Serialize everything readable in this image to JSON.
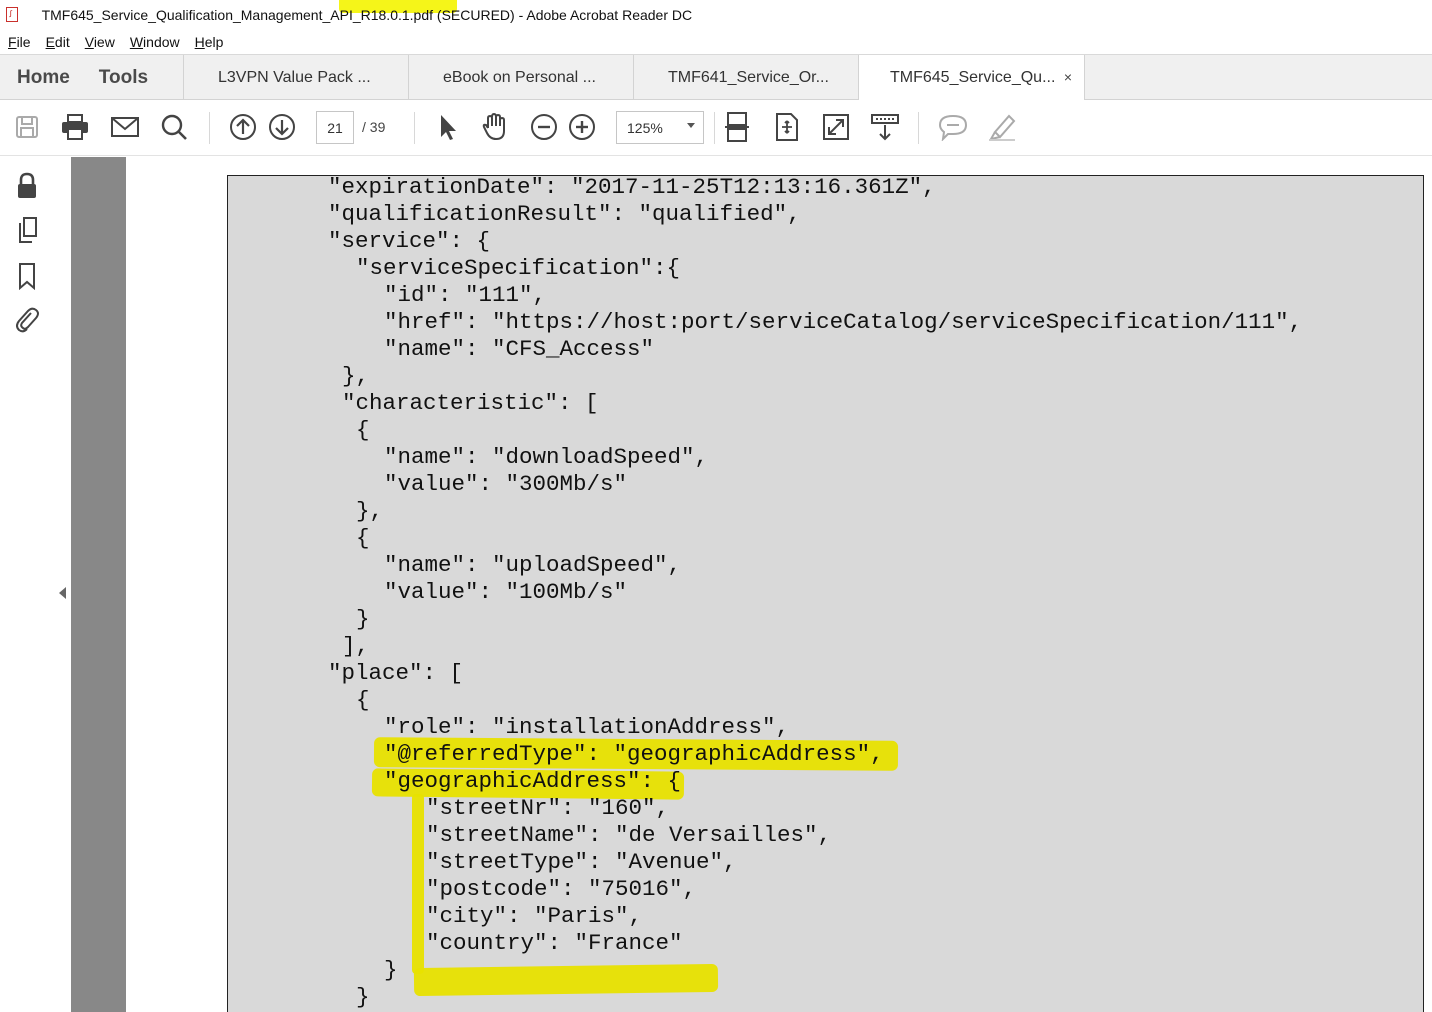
{
  "window": {
    "title_prefix": "TMF645_Service_Qualification_Management_A",
    "title_highlighted": "PI_R18.0.1.pdf",
    "title_suffix": " (SECURED) - Adobe Acrobat Reader DC"
  },
  "menu": {
    "items": [
      {
        "first": "F",
        "rest": "ile"
      },
      {
        "first": "E",
        "rest": "dit"
      },
      {
        "first": "V",
        "rest": "iew"
      },
      {
        "first": "W",
        "rest": "indow"
      },
      {
        "first": "H",
        "rest": "elp"
      }
    ]
  },
  "nav": {
    "home": "Home",
    "tools": "Tools"
  },
  "tabs": [
    {
      "label": "L3VPN Value Pack ..."
    },
    {
      "label": "eBook on Personal ..."
    },
    {
      "label": "TMF641_Service_Or..."
    },
    {
      "label": "TMF645_Service_Qu...",
      "close": "×"
    }
  ],
  "toolbar": {
    "current_page": "21",
    "total_pages": "/ 39",
    "zoom": "125%",
    "icons": [
      "save-icon",
      "print-icon",
      "email-icon",
      "search-icon",
      "page-up-icon",
      "page-down-icon",
      "select-cursor-icon",
      "hand-icon",
      "zoom-out-icon",
      "zoom-in-icon",
      "fit-page-icon",
      "rotate-icon",
      "full-screen-icon",
      "scroll-mode-icon",
      "comment-icon",
      "highlight-pen-icon"
    ]
  },
  "rail": {
    "icons": [
      "lock-icon",
      "pages-icon",
      "bookmark-icon",
      "attachment-icon"
    ]
  },
  "document": {
    "lines": [
      "\"expirationDate\": \"2017-11-25T12:13:16.361Z\",",
      "\"qualificationResult\": \"qualified\",",
      "\"service\": {",
      "\"serviceSpecification\":{",
      "\"id\": \"111\",",
      "\"href\": \"https://host:port/serviceCatalog/serviceSpecification/111\",",
      "\"name\": \"CFS_Access\"",
      "},",
      "\"characteristic\": [",
      "{",
      "\"name\": \"downloadSpeed\",",
      "\"value\": \"300Mb/s\"",
      "},",
      "{",
      "\"name\": \"uploadSpeed\",",
      "\"value\": \"100Mb/s\"",
      "}",
      "],",
      "\"place\": [",
      "{",
      "\"role\": \"installationAddress\",",
      "\"@referredType\": \"geographicAddress\",",
      "\"geographicAddress\": {",
      "\"streetNr\": \"160\",",
      "\"streetName\": \"de Versailles\",",
      "\"streetType\": \"Avenue\",",
      "\"postcode\": \"75016\",",
      "\"city\": \"Paris\",",
      "\"country\": \"France\"",
      "}",
      "}"
    ]
  },
  "colors": {
    "highlight": "#e8e200",
    "page_background": "#d9d9d9",
    "dark_strip": "#888888"
  }
}
